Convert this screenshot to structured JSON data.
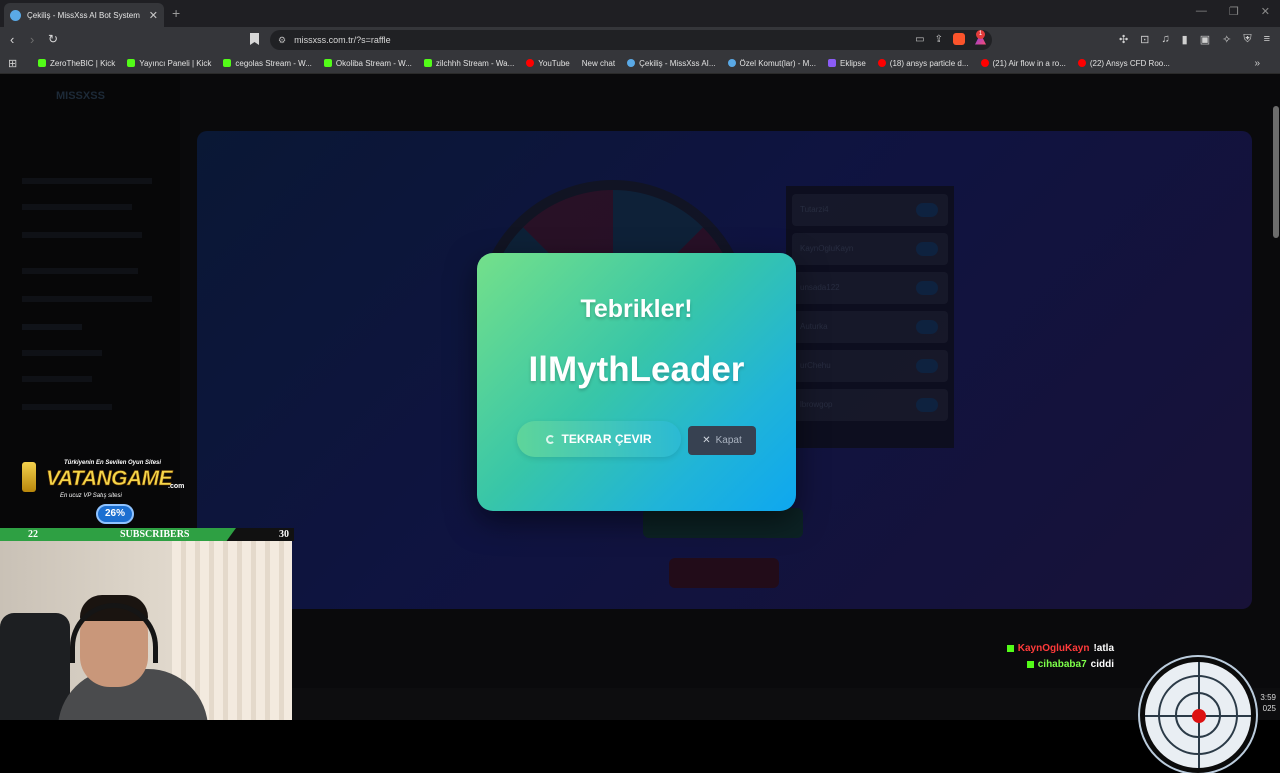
{
  "browser": {
    "tab_title": "Çekiliş - MissXss AI Bot System",
    "url": "missxss.com.tr/?s=raffle",
    "extension_badge": "1",
    "bookmarks": [
      {
        "label": "ZeroTheBIC | Kick",
        "icon": "kick"
      },
      {
        "label": "Yayıncı Paneli | Kick",
        "icon": "kick"
      },
      {
        "label": "cegolas Stream - W...",
        "icon": "kick"
      },
      {
        "label": "Okoliba Stream - W...",
        "icon": "kick"
      },
      {
        "label": "zilchhh Stream - Wa...",
        "icon": "kick"
      },
      {
        "label": "YouTube",
        "icon": "yt"
      },
      {
        "label": "New chat",
        "icon": "chat"
      },
      {
        "label": "Çekiliş - MissXss AI...",
        "icon": "site"
      },
      {
        "label": "Özel Komut(lar) - M...",
        "icon": "site"
      },
      {
        "label": "Eklipse",
        "icon": "ecl"
      },
      {
        "label": "(18) ansys particle d...",
        "icon": "yt"
      },
      {
        "label": "(21) Air flow in a ro...",
        "icon": "yt"
      },
      {
        "label": "(22) Ansys CFD Roo...",
        "icon": "yt"
      }
    ]
  },
  "page": {
    "logo": "MISSXSS",
    "participants": [
      "Tutarzi4",
      "KaynOgluKayn",
      "unsada122",
      "Auturka",
      "urChehu",
      "lbrowgop"
    ]
  },
  "modal": {
    "title": "Tebrikler!",
    "winner": "IlMythLeader",
    "spin_again_label": "TEKRAR ÇEVIR",
    "close_label": "Kapat"
  },
  "overlay": {
    "ad_tagline": "Türkiyenin En Sevilen Oyun Sitesi",
    "ad_brand": "VATANGAME",
    "ad_domain": ".com",
    "ad_sub": "En ucuz VP Satış sitesi",
    "percent": "26%",
    "subscribers_current": "22",
    "subscribers_label": "SUBSCRIBERS",
    "subscribers_goal": "30",
    "chat": [
      {
        "user": "KaynOgluKayn",
        "message": "!atla"
      },
      {
        "user": "cihababa7",
        "message": "ciddi"
      }
    ],
    "clock_time": "3:59",
    "clock_date": "025"
  },
  "colors": {
    "modal_gradient_start": "#74e08a",
    "modal_gradient_end": "#0ea7f0",
    "close_button": "#374151",
    "kick_green": "#53fc18"
  }
}
